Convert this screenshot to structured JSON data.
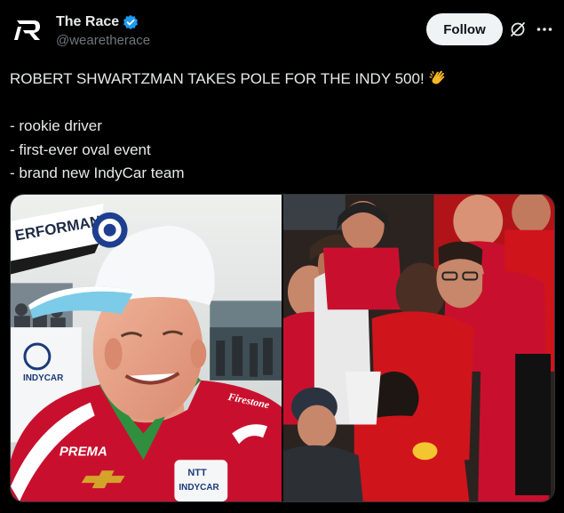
{
  "author": {
    "display_name": "The Race",
    "handle": "@wearetherace",
    "verified": true,
    "avatar_icon": "the-race-logo-icon"
  },
  "actions": {
    "follow_label": "Follow",
    "grok_icon": "grok-icon",
    "more_icon": "more-options-icon"
  },
  "tweet": {
    "headline": "ROBERT SHWARTZMAN TAKES POLE FOR THE INDY 500!",
    "emoji": "clapping-hands",
    "bullets": [
      "- rookie driver",
      "- first-ever oval event",
      "- brand new IndyCar team"
    ]
  },
  "media": {
    "left_photo": {
      "banner_text": "ERFORMAN",
      "cap_logo": "prema-logo",
      "chest_logo_1": "NTT",
      "chest_logo_2": "INDYCAR",
      "suit_text_1": "PREMA",
      "suit_text_2": "Firestone",
      "board_text": "INDYCAR"
    },
    "right_photo": {
      "description_icon": "team-celebration-photo"
    }
  },
  "colors": {
    "verified_blue": "#1d9bf0",
    "follow_bg": "#eff3f4",
    "muted": "#71767b",
    "suit_red": "#c8102e"
  }
}
